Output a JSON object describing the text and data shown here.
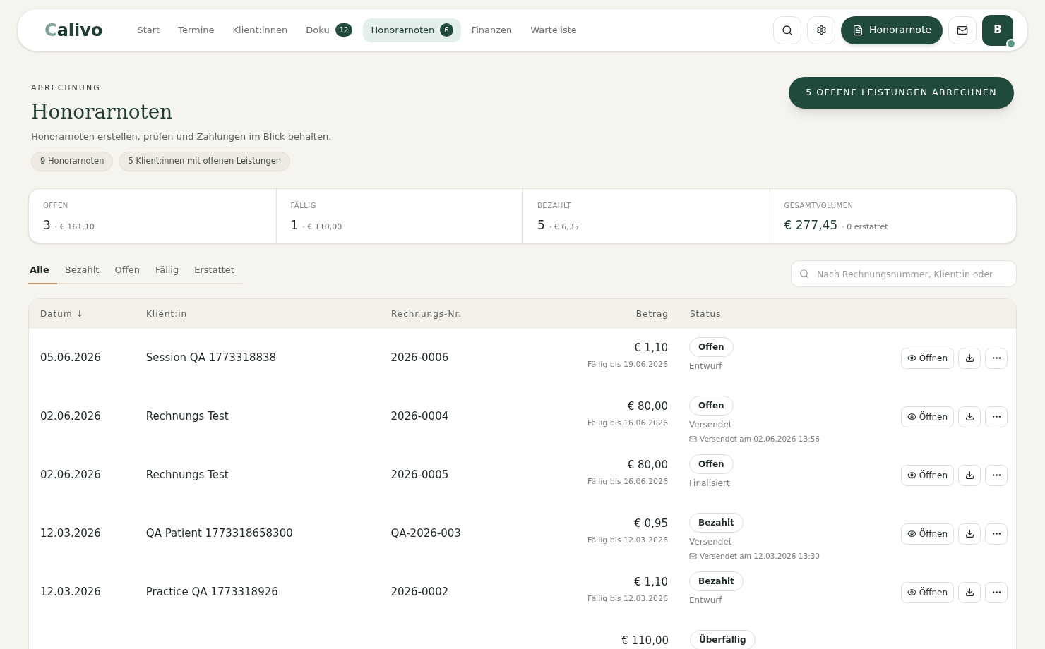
{
  "nav": {
    "logo_initial": "C",
    "logo_rest": "alivo",
    "items": [
      {
        "label": "Start",
        "selected": false
      },
      {
        "label": "Termine",
        "selected": false
      },
      {
        "label": "Klient:innen",
        "selected": false
      },
      {
        "label": "Doku",
        "badge": "12",
        "selected": false
      },
      {
        "label": "Honorarnoten",
        "badge": "6",
        "selected": true
      },
      {
        "label": "Finanzen",
        "selected": false
      },
      {
        "label": "Warteliste",
        "selected": false
      }
    ],
    "new_button": "Honorarnote",
    "avatar": "B",
    "online": true
  },
  "header": {
    "eyebrow": "ABRECHNUNG",
    "title": "Honorarnoten",
    "subtitle": "Honorarnoten erstellen, prüfen und Zahlungen im Blick behalten.",
    "chips": [
      "9 Honorarnoten",
      "5 Klient:innen mit offenen Leistungen"
    ],
    "action": "5 OFFENE LEISTUNGEN ABRECHNEN"
  },
  "stats": [
    {
      "label": "OFFEN",
      "value": "3",
      "detail": "· € 161,10"
    },
    {
      "label": "FÄLLIG",
      "value": "1",
      "detail": "· € 110,00"
    },
    {
      "label": "BEZAHLT",
      "value": "5",
      "detail": "· € 6,35"
    },
    {
      "label": "GESAMTVOLUMEN",
      "value": "€ 277,45",
      "detail": "· 0 erstattet"
    }
  ],
  "filters": [
    {
      "label": "Alle",
      "selected": true
    },
    {
      "label": "Bezahlt",
      "selected": false
    },
    {
      "label": "Offen",
      "selected": false
    },
    {
      "label": "Fällig",
      "selected": false
    },
    {
      "label": "Erstattet",
      "selected": false
    }
  ],
  "search": {
    "placeholder": "Nach Rechnungsnummer, Klient:in oder"
  },
  "table": {
    "columns": [
      "Datum ↓",
      "Klient:in",
      "Rechnungs-Nr.",
      "Betrag",
      "Status"
    ],
    "rows": [
      {
        "date": "05.06.2026",
        "client": "Session QA 1773318838",
        "number": "2026-0006",
        "amount": "€ 1,10",
        "due": "Fällig bis 19.06.2026",
        "status": "Offen",
        "stage": "Entwurf",
        "open": "Öffnen"
      },
      {
        "date": "02.06.2026",
        "client": "Rechnungs Test",
        "number": "2026-0004",
        "amount": "€ 80,00",
        "due": "Fällig bis 16.06.2026",
        "status": "Offen",
        "stage": "Versendet",
        "sent": "Versendet am 02.06.2026 13:56",
        "open": "Öffnen"
      },
      {
        "date": "02.06.2026",
        "client": "Rechnungs Test",
        "number": "2026-0005",
        "amount": "€ 80,00",
        "due": "Fällig bis 16.06.2026",
        "status": "Offen",
        "stage": "Finalisiert",
        "open": "Öffnen"
      },
      {
        "date": "12.03.2026",
        "client": "QA Patient 1773318658300",
        "number": "QA-2026-003",
        "amount": "€ 0,95",
        "due": "Fällig bis 12.03.2026",
        "status": "Bezahlt",
        "stage": "Versendet",
        "sent": "Versendet am 12.03.2026 13:30",
        "open": "Öffnen"
      },
      {
        "date": "12.03.2026",
        "client": "Practice QA 1773318926",
        "number": "2026-0002",
        "amount": "€ 1,10",
        "due": "Fällig bis 12.03.2026",
        "status": "Bezahlt",
        "stage": "Entwurf",
        "open": "Öffnen"
      },
      {
        "amount": "€ 110,00",
        "status": "Überfällig"
      }
    ]
  }
}
